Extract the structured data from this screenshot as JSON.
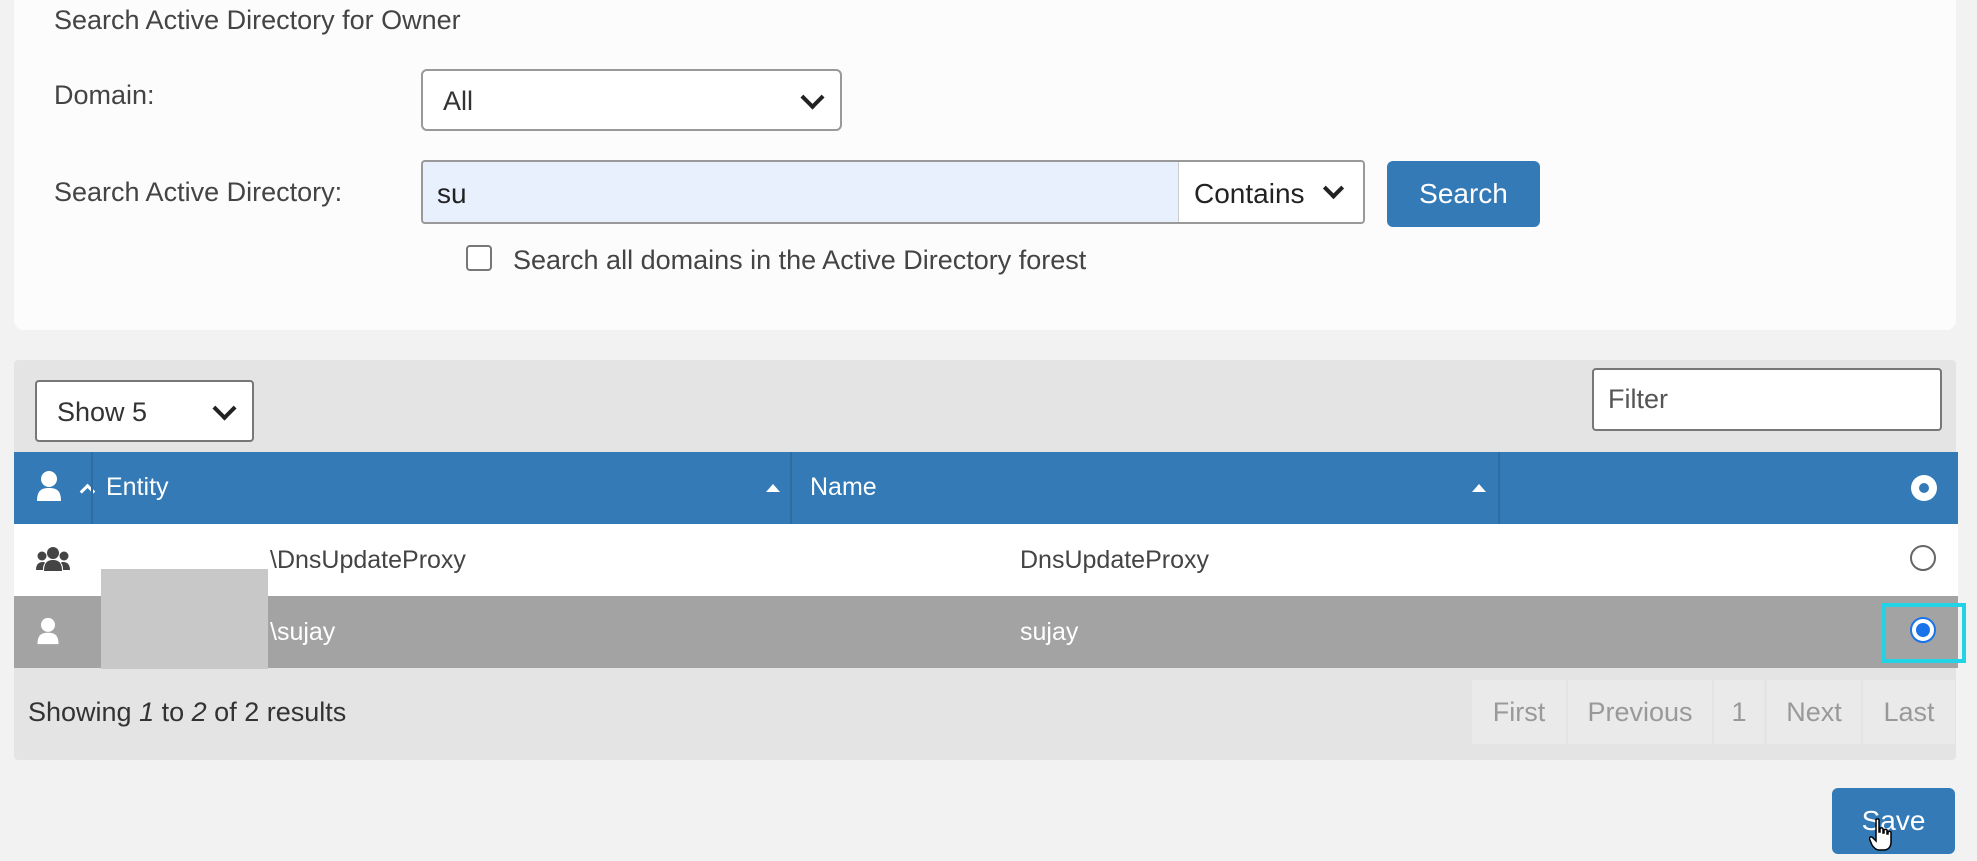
{
  "search_panel": {
    "title": "Search Active Directory for Owner",
    "domain_label": "Domain:",
    "domain_value": "All",
    "search_label": "Search Active Directory:",
    "search_value": "su",
    "match_mode": "Contains",
    "search_button": "Search",
    "all_domains_label": "Search all domains in the Active Directory forest",
    "all_domains_checked": false
  },
  "results": {
    "page_size": "Show 5",
    "filter_placeholder": "Filter",
    "columns": {
      "entity": "Entity",
      "name": "Name"
    },
    "rows": [
      {
        "type_icon": "group-icon",
        "entity": "\\DnsUpdateProxy",
        "name": "DnsUpdateProxy",
        "selected": false
      },
      {
        "type_icon": "user-icon",
        "entity": "\\sujay",
        "name": "sujay",
        "selected": true
      }
    ],
    "summary": {
      "prefix": "Showing ",
      "from": "1",
      "to_word": " to ",
      "to": "2",
      "of_word": " of ",
      "total": "2",
      "suffix": " results"
    },
    "pagination": {
      "first": "First",
      "previous": "Previous",
      "page": "1",
      "next": "Next",
      "last": "Last"
    }
  },
  "save_button": "Save",
  "colors": {
    "primary": "#337ab7",
    "selected_row": "#a3a3a3",
    "highlight": "#22d3e6"
  }
}
